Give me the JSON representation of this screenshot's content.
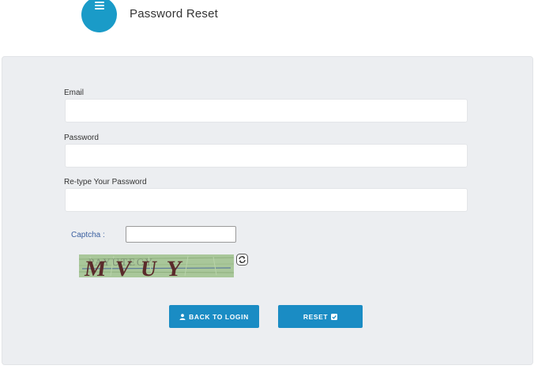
{
  "header": {
    "title": "Password Reset",
    "icon": "menu-icon",
    "accent_color": "#1a9bc8"
  },
  "form": {
    "email_label": "Email",
    "email_value": "",
    "password_label": "Password",
    "password_value": "",
    "retype_label": "Re-type Your Password",
    "retype_value": "",
    "captcha_label": "Captcha :",
    "captcha_value": "",
    "captcha_image_text": "MVUY",
    "captcha_refresh_icon": "refresh-icon"
  },
  "buttons": {
    "back_label": "BACK TO LOGIN",
    "back_icon": "user-icon",
    "reset_label": "RESET",
    "reset_icon": "check-square-icon",
    "color": "#1a8cc4"
  }
}
